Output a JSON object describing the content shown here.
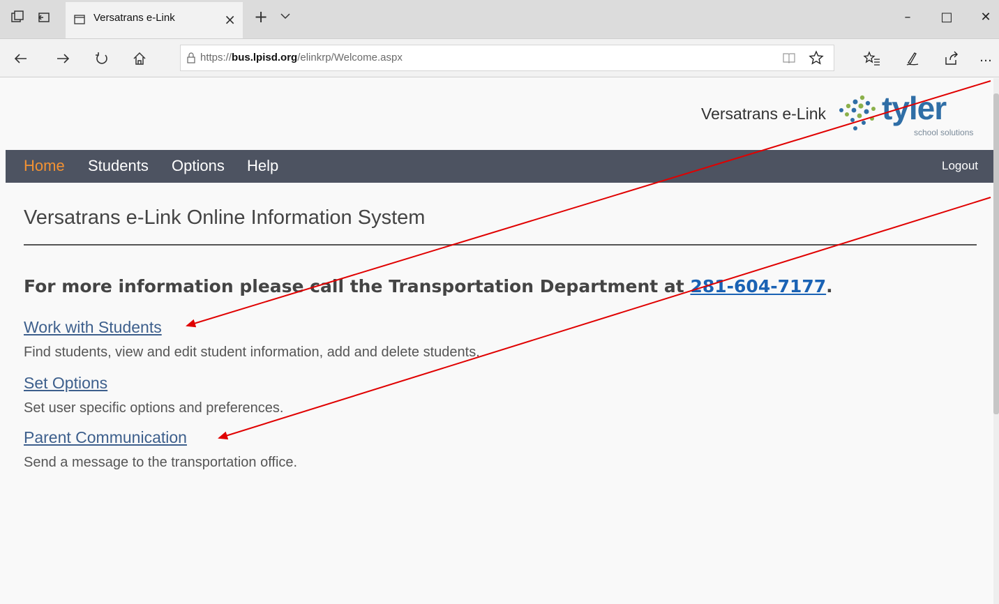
{
  "browser": {
    "tab_title": "Versatrans e-Link",
    "tab_close": "×",
    "new_tab": "+",
    "url_prefix": "https://",
    "url_host": "bus.lpisd.org",
    "url_path": "/elinkrp/Welcome.aspx",
    "window_minimize": "–",
    "window_maximize": "□",
    "window_close": "✕",
    "more": "…"
  },
  "header": {
    "brand_text": "Versatrans e-Link",
    "logo_word": "tyler",
    "logo_sub": "school solutions"
  },
  "menu": {
    "items": [
      "Home",
      "Students",
      "Options",
      "Help"
    ],
    "logout": "Logout"
  },
  "main": {
    "title": "Versatrans e-Link Online Information System",
    "info_prefix": "For more information please call the Transportation Department at ",
    "phone": "281-604-7177",
    "info_suffix": ".",
    "links": [
      {
        "label": "Work with Students",
        "desc": "Find students, view and edit student information, add and delete students."
      },
      {
        "label": "Set Options",
        "desc": "Set user specific options and preferences."
      },
      {
        "label": "Parent Communication",
        "desc": "Send a message to the transportation office."
      }
    ]
  },
  "colors": {
    "menu_bg": "#4d5361",
    "menu_active": "#f39233",
    "link": "#3d5f8c",
    "phone_link": "#1a62b4",
    "annotation_arrow": "#e00000"
  }
}
